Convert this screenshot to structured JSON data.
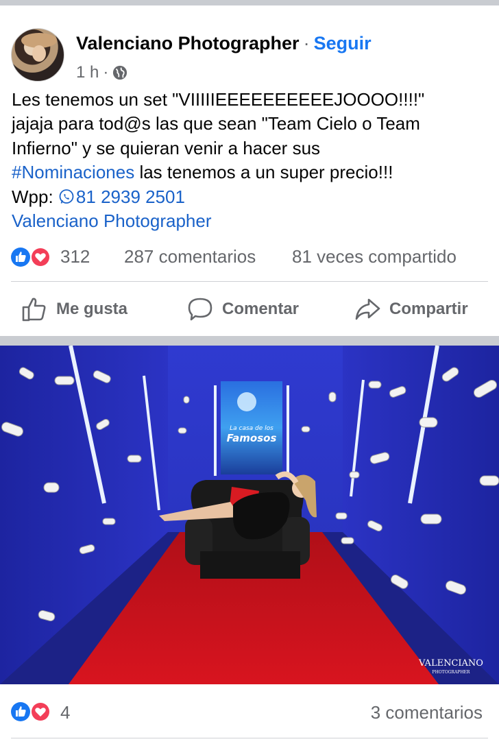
{
  "post": {
    "author": "Valenciano Photographer",
    "separator": "·",
    "follow_label": "Seguir",
    "time": "1 h",
    "meta_separator": "·",
    "privacy_icon": "globe-icon",
    "text_lines": [
      "Les tenemos un set \"VIIIIIEEEEEEEEEEJOOOO!!!!\"",
      "jajaja  para tod@s las que sean \"Team Cielo o Team",
      "Infierno\" y se quieran venir a hacer sus"
    ],
    "hashtag": "#Nominaciones",
    "line4_rest": " las tenemos a un super precio!!!",
    "wpp_label": "Wpp: ",
    "phone": "81 2939 2501",
    "page_link": "Valenciano Photographer"
  },
  "stats": {
    "reactions_count": "312",
    "comments": "287 comentarios",
    "shares": "81 veces compartido",
    "reaction_icons": [
      "like-icon",
      "love-icon"
    ]
  },
  "actions": {
    "like": "Me gusta",
    "comment": "Comentar",
    "share": "Compartir"
  },
  "photo": {
    "screen_logo_line1": "La casa de los",
    "screen_logo_line2": "Famosos",
    "watermark_line1": "VALENCIANO",
    "watermark_line2": "PHOTOGRAPHER"
  },
  "photo_stats": {
    "reactions_count": "4",
    "comments": "3 comentarios"
  },
  "colors": {
    "facebook_blue": "#1877f2",
    "link_blue": "#1a62c9",
    "muted_text": "#65676b",
    "wall_blue": "#2b2fb8",
    "carpet_red": "#c8111a"
  }
}
